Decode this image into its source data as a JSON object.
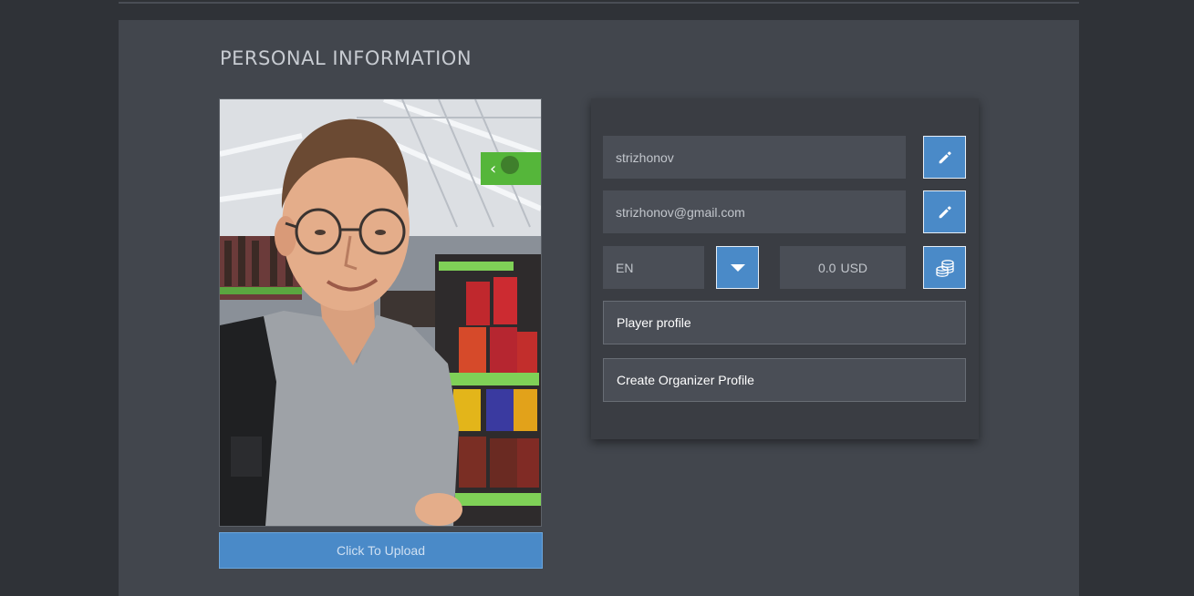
{
  "section": {
    "title": "PERSONAL INFORMATION"
  },
  "photo": {
    "alt": "profile photo",
    "upload_label": "Click To Upload"
  },
  "profile": {
    "username": "strizhonov",
    "email": "strizhonov@gmail.com",
    "language": "EN",
    "balance_amount": "0.0",
    "balance_currency": "USD",
    "player_profile_label": "Player profile",
    "create_organizer_label": "Create Organizer Profile"
  },
  "icons": {
    "edit_username": "pencil-icon",
    "edit_email": "pencil-icon",
    "language_dropdown": "caret-down-icon",
    "balance": "coins-icon"
  },
  "colors": {
    "accent": "#4a8ac8",
    "panel": "#42464d",
    "card": "#3a3d43",
    "field": "#4a4e56"
  }
}
